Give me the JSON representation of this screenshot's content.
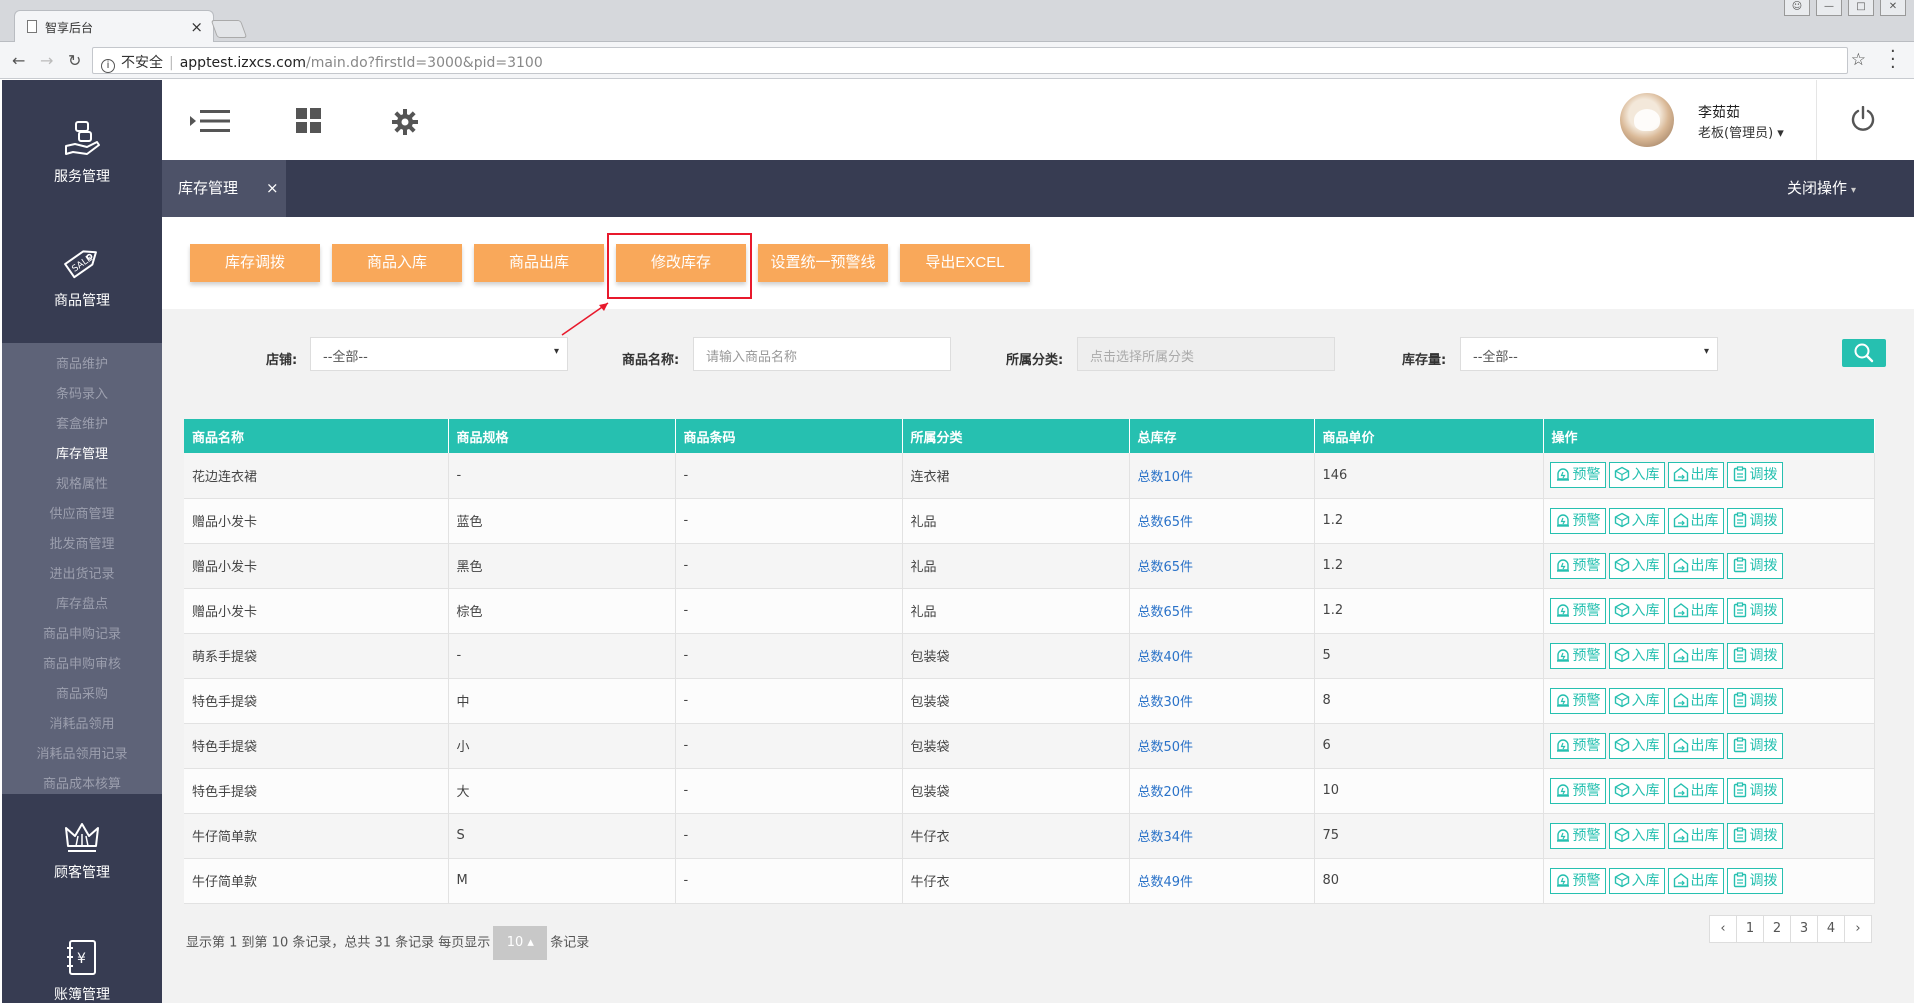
{
  "browser": {
    "tab_title": "智享后台",
    "insecure_label": "不安全",
    "url_host": "apptest.izxcs.com",
    "url_path": "/main.do?firstId=3000&pid=3100"
  },
  "sidebar": {
    "sections": [
      {
        "label": "服务管理",
        "icon": "service-hand-icon"
      },
      {
        "label": "商品管理",
        "icon": "sale-tag-icon"
      },
      {
        "label": "顾客管理",
        "icon": "crown-icon"
      },
      {
        "label": "账簿管理",
        "icon": "ledger-icon"
      }
    ],
    "submenu": [
      {
        "label": "商品维护"
      },
      {
        "label": "条码录入"
      },
      {
        "label": "套盒维护"
      },
      {
        "label": "库存管理"
      },
      {
        "label": "规格属性"
      },
      {
        "label": "供应商管理"
      },
      {
        "label": "批发商管理"
      },
      {
        "label": "进出货记录"
      },
      {
        "label": "库存盘点"
      },
      {
        "label": "商品申购记录"
      },
      {
        "label": "商品申购审核"
      },
      {
        "label": "商品采购"
      },
      {
        "label": "消耗品领用"
      },
      {
        "label": "消耗品领用记录"
      },
      {
        "label": "商品成本核算"
      }
    ],
    "active_item": "库存管理"
  },
  "header": {
    "user_name": "李茹茹",
    "user_role": "老板(管理员)",
    "role_caret": "▾"
  },
  "tabs": {
    "active": "库存管理",
    "close_symbol": "×",
    "close_ops": "关闭操作",
    "close_ops_caret": "▾"
  },
  "actions": [
    {
      "label": "库存调拨"
    },
    {
      "label": "商品入库"
    },
    {
      "label": "商品出库"
    },
    {
      "label": "修改库存"
    },
    {
      "label": "设置统一预警线"
    },
    {
      "label": "导出EXCEL"
    }
  ],
  "highlighted_action": "修改库存",
  "filters": {
    "store_label": "店铺:",
    "store_value": "--全部--",
    "name_label": "商品名称:",
    "name_placeholder": "请输入商品名称",
    "category_label": "所属分类:",
    "category_placeholder": "点击选择所属分类",
    "stock_label": "库存量:",
    "stock_value": "--全部--",
    "dropdown_caret": "▾"
  },
  "table": {
    "columns": [
      "商品名称",
      "商品规格",
      "商品条码",
      "所属分类",
      "总库存",
      "商品单价",
      "操作"
    ],
    "rows": [
      {
        "name": "花边连衣裙",
        "spec": "-",
        "barcode": "-",
        "category": "连衣裙",
        "stock": "总数10件",
        "price": "146"
      },
      {
        "name": "赠品小发卡",
        "spec": "蓝色",
        "barcode": "-",
        "category": "礼品",
        "stock": "总数65件",
        "price": "1.2"
      },
      {
        "name": "赠品小发卡",
        "spec": "黑色",
        "barcode": "-",
        "category": "礼品",
        "stock": "总数65件",
        "price": "1.2"
      },
      {
        "name": "赠品小发卡",
        "spec": "棕色",
        "barcode": "-",
        "category": "礼品",
        "stock": "总数65件",
        "price": "1.2"
      },
      {
        "name": "萌系手提袋",
        "spec": "-",
        "barcode": "-",
        "category": "包装袋",
        "stock": "总数40件",
        "price": "5"
      },
      {
        "name": "特色手提袋",
        "spec": "中",
        "barcode": "-",
        "category": "包装袋",
        "stock": "总数30件",
        "price": "8"
      },
      {
        "name": "特色手提袋",
        "spec": "小",
        "barcode": "-",
        "category": "包装袋",
        "stock": "总数50件",
        "price": "6"
      },
      {
        "name": "特色手提袋",
        "spec": "大",
        "barcode": "-",
        "category": "包装袋",
        "stock": "总数20件",
        "price": "10"
      },
      {
        "name": "牛仔简单款",
        "spec": "S",
        "barcode": "-",
        "category": "牛仔衣",
        "stock": "总数34件",
        "price": "75"
      },
      {
        "name": "牛仔简单款",
        "spec": "M",
        "barcode": "-",
        "category": "牛仔衣",
        "stock": "总数49件",
        "price": "80"
      }
    ],
    "row_actions": [
      "预警",
      "入库",
      "出库",
      "调拨"
    ]
  },
  "pagination": {
    "info_prefix": "显示第 1 到第 10 条记录，总共 31 条记录 每页显示",
    "page_size": "10",
    "page_size_caret": "▴",
    "info_suffix": "条记录",
    "pages": [
      "‹",
      "1",
      "2",
      "3",
      "4",
      "›"
    ]
  },
  "colors": {
    "sidebar_bg": "#373c52",
    "submenu_bg": "#5e6378",
    "accent_teal": "#26c0b0",
    "action_orange": "#f9a85a",
    "highlight_red": "#e8192c",
    "link_blue": "#2a72c8"
  }
}
